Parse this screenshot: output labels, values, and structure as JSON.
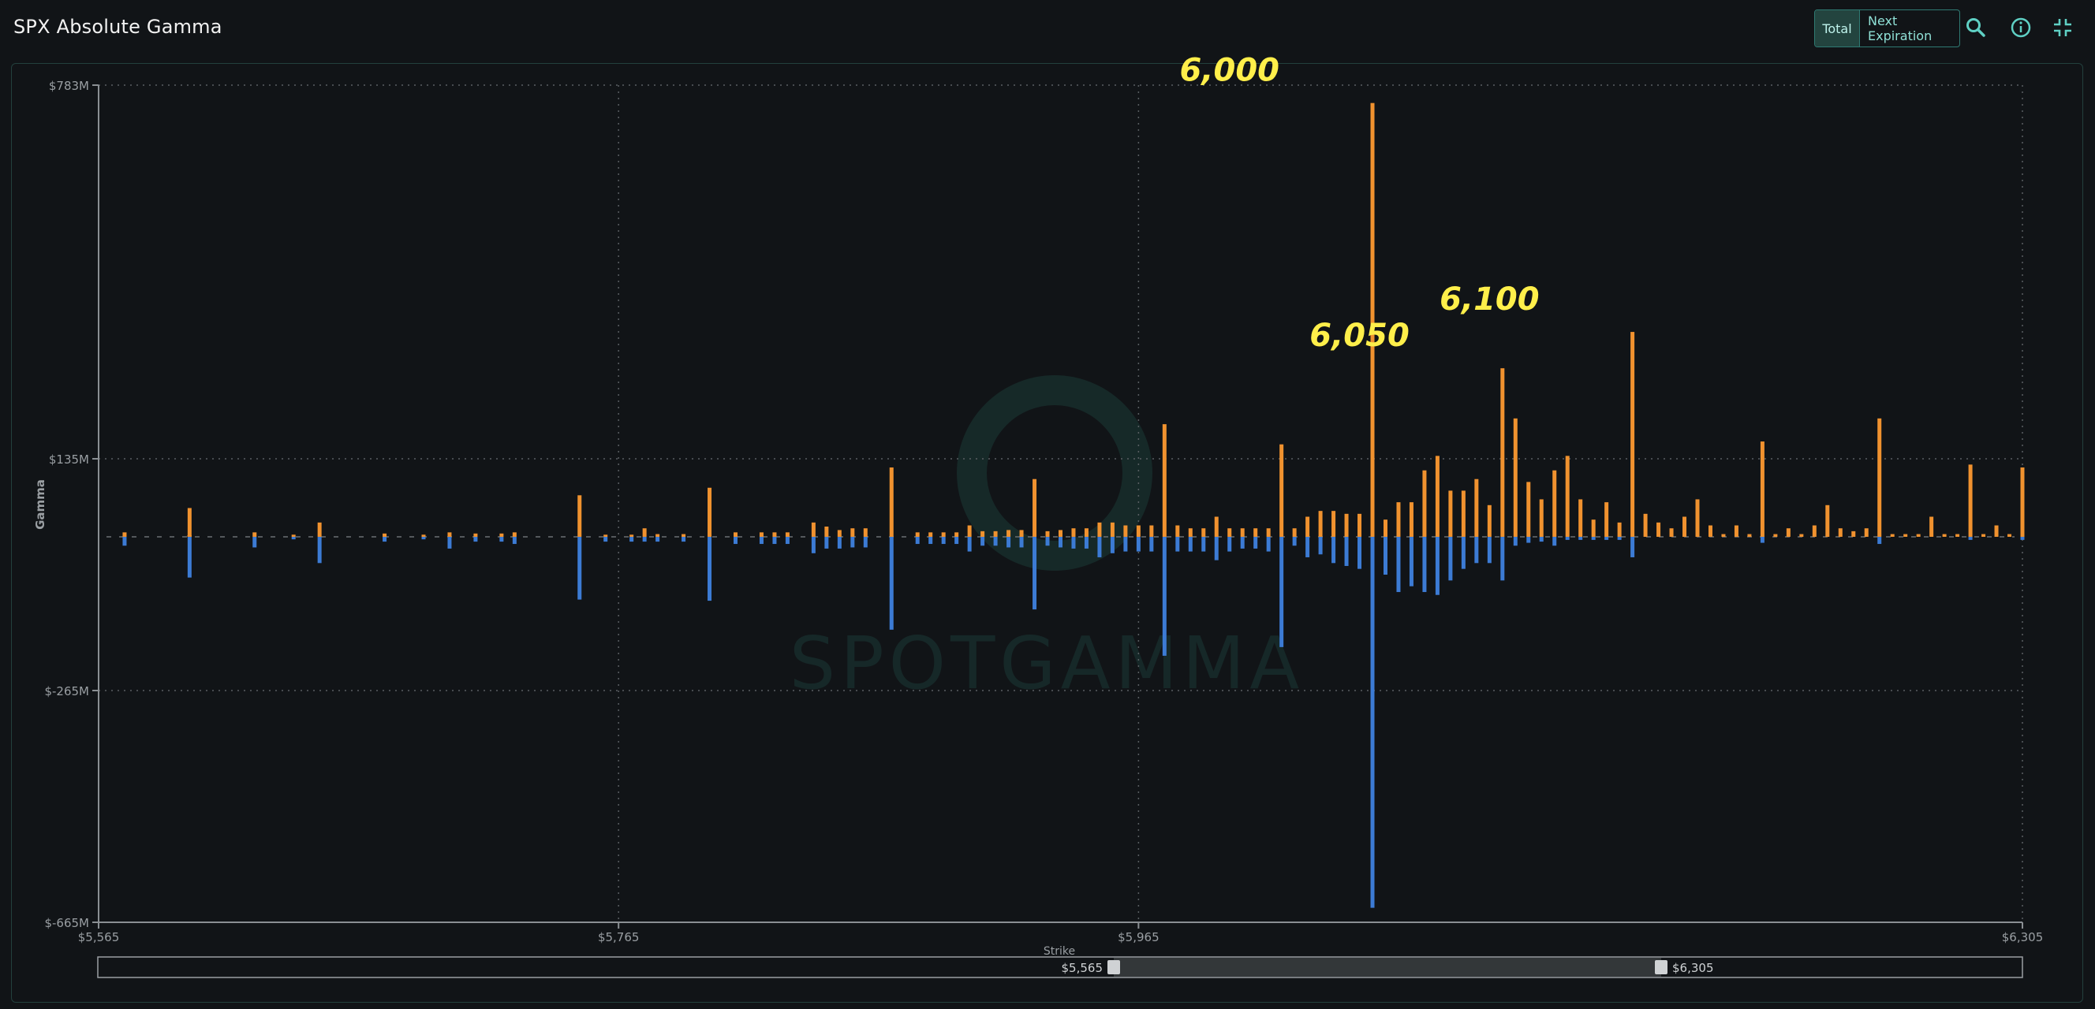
{
  "app": {
    "title": "SPX Absolute Gamma",
    "toggle": {
      "total_label": "Total",
      "next_label": "Next Expiration",
      "selected": "Total"
    },
    "icons": [
      "search-icon",
      "info-icon",
      "collapse-icon"
    ]
  },
  "chart_data": {
    "type": "bar",
    "title": "SPX Absolute Gamma",
    "xlabel": "Strike",
    "ylabel": "Gamma",
    "xlim": [
      5565,
      6305
    ],
    "ylim": [
      -665,
      783
    ],
    "y_unit": "$M",
    "x_ticks": [
      "$5,565",
      "$5,765",
      "$5,965",
      "$6,305"
    ],
    "y_ticks": [
      "$783M",
      "$135M",
      "$-265M",
      "$-665M"
    ],
    "grid": true,
    "colors": {
      "positive": "#f0922f",
      "negative": "#3c7bd4",
      "annotation": "#ffef4a",
      "watermark": "#1b3a37"
    },
    "watermark": "SPOTGAMMA",
    "annotations": [
      {
        "label": "6,000",
        "strike": 6000,
        "value": 752
      },
      {
        "label": "6,050",
        "strike": 6050,
        "value": 292
      },
      {
        "label": "6,100",
        "strike": 6100,
        "value": 355
      }
    ],
    "range_slider": {
      "min_label": "$5,565",
      "max_label": "$6,305",
      "low": 5565,
      "high": 6305
    },
    "series": [
      {
        "name": "Call Gamma",
        "points": [
          [
            5575,
            8
          ],
          [
            5600,
            3
          ],
          [
            5600,
            3
          ],
          [
            5600,
            3
          ],
          [
            5600,
            3
          ],
          [
            5600,
            3
          ],
          [
            5600,
            3
          ],
          [
            5600,
            3
          ],
          [
            5600,
            3
          ],
          [
            5600,
            50
          ],
          [
            5625,
            8
          ],
          [
            5640,
            4
          ],
          [
            5650,
            25
          ],
          [
            5675,
            6
          ],
          [
            5690,
            4
          ],
          [
            5700,
            8
          ],
          [
            5710,
            6
          ],
          [
            5720,
            6
          ],
          [
            5725,
            8
          ],
          [
            5750,
            72
          ],
          [
            5760,
            4
          ],
          [
            5770,
            4
          ],
          [
            5775,
            15
          ],
          [
            5780,
            5
          ],
          [
            5790,
            5
          ],
          [
            5800,
            85
          ],
          [
            5810,
            8
          ],
          [
            5820,
            8
          ],
          [
            5825,
            8
          ],
          [
            5830,
            8
          ],
          [
            5840,
            25
          ],
          [
            5845,
            18
          ],
          [
            5850,
            12
          ],
          [
            5855,
            15
          ],
          [
            5860,
            15
          ],
          [
            5870,
            120
          ],
          [
            5880,
            8
          ],
          [
            5885,
            8
          ],
          [
            5890,
            8
          ],
          [
            5895,
            8
          ],
          [
            5900,
            20
          ],
          [
            5905,
            10
          ],
          [
            5910,
            10
          ],
          [
            5915,
            12
          ],
          [
            5920,
            12
          ],
          [
            5925,
            100
          ],
          [
            5930,
            10
          ],
          [
            5935,
            12
          ],
          [
            5940,
            15
          ],
          [
            5945,
            15
          ],
          [
            5950,
            25
          ],
          [
            5955,
            25
          ],
          [
            5960,
            20
          ],
          [
            5965,
            20
          ],
          [
            5970,
            20
          ],
          [
            5975,
            195
          ],
          [
            5980,
            20
          ],
          [
            5985,
            15
          ],
          [
            5990,
            15
          ],
          [
            5995,
            35
          ],
          [
            6000,
            15
          ],
          [
            6005,
            15
          ],
          [
            6010,
            15
          ],
          [
            6015,
            15
          ],
          [
            6020,
            160
          ],
          [
            6025,
            15
          ],
          [
            6030,
            35
          ],
          [
            6035,
            45
          ],
          [
            6040,
            45
          ],
          [
            6045,
            40
          ],
          [
            6050,
            40
          ],
          [
            6055,
            752
          ],
          [
            6060,
            30
          ],
          [
            6065,
            60
          ],
          [
            6070,
            60
          ],
          [
            6075,
            115
          ],
          [
            6080,
            140
          ],
          [
            6085,
            80
          ],
          [
            6090,
            80
          ],
          [
            6095,
            100
          ],
          [
            6100,
            55
          ],
          [
            6105,
            292
          ],
          [
            6110,
            205
          ],
          [
            6115,
            95
          ],
          [
            6120,
            65
          ],
          [
            6125,
            115
          ],
          [
            6130,
            140
          ],
          [
            6135,
            65
          ],
          [
            6140,
            30
          ],
          [
            6145,
            60
          ],
          [
            6150,
            25
          ],
          [
            6155,
            355
          ],
          [
            6160,
            40
          ],
          [
            6165,
            25
          ],
          [
            6170,
            15
          ],
          [
            6175,
            35
          ],
          [
            6180,
            65
          ],
          [
            6185,
            20
          ],
          [
            6190,
            5
          ],
          [
            6195,
            20
          ],
          [
            6200,
            5
          ],
          [
            6205,
            165
          ],
          [
            6210,
            5
          ],
          [
            6215,
            15
          ],
          [
            6220,
            5
          ],
          [
            6225,
            20
          ],
          [
            6230,
            55
          ],
          [
            6235,
            15
          ],
          [
            6240,
            10
          ],
          [
            6245,
            15
          ],
          [
            6250,
            205
          ],
          [
            6255,
            5
          ],
          [
            6260,
            5
          ],
          [
            6265,
            5
          ],
          [
            6270,
            35
          ],
          [
            6275,
            5
          ],
          [
            6280,
            5
          ],
          [
            6285,
            125
          ],
          [
            6290,
            5
          ],
          [
            6295,
            20
          ],
          [
            6300,
            5
          ],
          [
            6305,
            120
          ]
        ]
      },
      {
        "name": "Put Gamma",
        "points": [
          [
            5575,
            -15
          ],
          [
            5600,
            -70
          ],
          [
            5625,
            -18
          ],
          [
            5640,
            -4
          ],
          [
            5650,
            -45
          ],
          [
            5675,
            -8
          ],
          [
            5690,
            -4
          ],
          [
            5700,
            -20
          ],
          [
            5710,
            -8
          ],
          [
            5720,
            -8
          ],
          [
            5725,
            -12
          ],
          [
            5750,
            -108
          ],
          [
            5760,
            -8
          ],
          [
            5770,
            -8
          ],
          [
            5775,
            -8
          ],
          [
            5780,
            -8
          ],
          [
            5790,
            -8
          ],
          [
            5800,
            -110
          ],
          [
            5810,
            -12
          ],
          [
            5820,
            -12
          ],
          [
            5825,
            -12
          ],
          [
            5830,
            -12
          ],
          [
            5840,
            -28
          ],
          [
            5845,
            -20
          ],
          [
            5850,
            -20
          ],
          [
            5855,
            -18
          ],
          [
            5860,
            -18
          ],
          [
            5870,
            -160
          ],
          [
            5880,
            -12
          ],
          [
            5885,
            -12
          ],
          [
            5890,
            -12
          ],
          [
            5895,
            -12
          ],
          [
            5900,
            -25
          ],
          [
            5905,
            -15
          ],
          [
            5910,
            -15
          ],
          [
            5915,
            -18
          ],
          [
            5920,
            -18
          ],
          [
            5925,
            -125
          ],
          [
            5930,
            -15
          ],
          [
            5935,
            -18
          ],
          [
            5940,
            -20
          ],
          [
            5945,
            -20
          ],
          [
            5950,
            -35
          ],
          [
            5955,
            -28
          ],
          [
            5960,
            -25
          ],
          [
            5965,
            -25
          ],
          [
            5970,
            -25
          ],
          [
            5975,
            -205
          ],
          [
            5980,
            -25
          ],
          [
            5985,
            -25
          ],
          [
            5990,
            -25
          ],
          [
            5995,
            -40
          ],
          [
            6000,
            -25
          ],
          [
            6005,
            -20
          ],
          [
            6010,
            -20
          ],
          [
            6015,
            -25
          ],
          [
            6020,
            -190
          ],
          [
            6025,
            -15
          ],
          [
            6030,
            -35
          ],
          [
            6035,
            -30
          ],
          [
            6040,
            -45
          ],
          [
            6045,
            -50
          ],
          [
            6050,
            -55
          ],
          [
            6055,
            -640
          ],
          [
            6060,
            -65
          ],
          [
            6065,
            -95
          ],
          [
            6070,
            -85
          ],
          [
            6075,
            -95
          ],
          [
            6080,
            -100
          ],
          [
            6085,
            -75
          ],
          [
            6090,
            -55
          ],
          [
            6095,
            -45
          ],
          [
            6100,
            -45
          ],
          [
            6105,
            -75
          ],
          [
            6110,
            -15
          ],
          [
            6115,
            -10
          ],
          [
            6120,
            -8
          ],
          [
            6125,
            -15
          ],
          [
            6130,
            -5
          ],
          [
            6135,
            -5
          ],
          [
            6140,
            -5
          ],
          [
            6145,
            -5
          ],
          [
            6150,
            -5
          ],
          [
            6155,
            -35
          ],
          [
            6205,
            -10
          ],
          [
            6250,
            -12
          ],
          [
            6285,
            -5
          ],
          [
            6305,
            -5
          ]
        ]
      }
    ]
  }
}
